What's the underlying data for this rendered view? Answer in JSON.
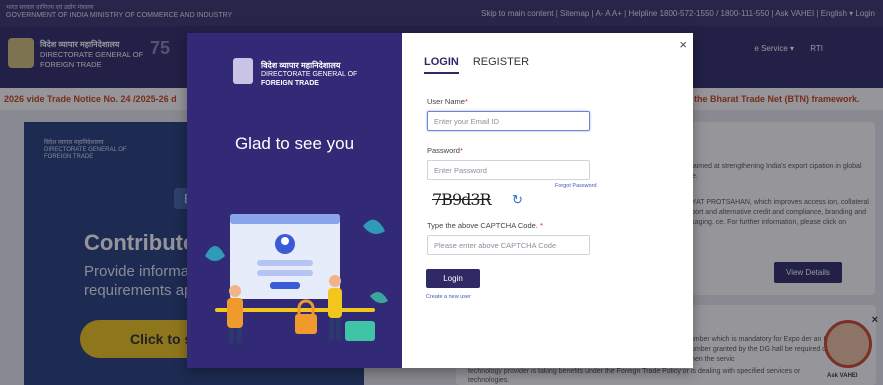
{
  "background": {
    "topbar": {
      "gov_hindi": "भारत सरकार वाणिज्य एवं उद्योग मंत्रालय",
      "gov_english": "GOVERNMENT OF INDIA MINISTRY OF COMMERCE AND INDUSTRY",
      "links": "Skip to main content  |  Sitemap  |  A-  A  A+  |  Helpline 1800-572-1550 / 1800-111-550  |  Ask VAHEI  |  English ▾  Login"
    },
    "header": {
      "hindi": "विदेश व्यापार महानिदेशालय",
      "line1": "DIRECTORATE GENERAL OF",
      "line2": "FOREIGN TRADE",
      "azadi": "75",
      "nav_items": [
        "e Service ▾",
        "RTI"
      ]
    },
    "ticker": {
      "left": "2026 vide Trade Notice No. 24 /2025-26 d",
      "right": "n the Bharat Trade Net (BTN) framework."
    },
    "banner": {
      "mini_hindi": "विदेश व्यापार महानिदेशालय",
      "mini_l1": "DIRECTORATE GENERAL OF",
      "mini_l2": "FOREIGN TRADE",
      "ex": "Ex",
      "title": "Contribute to In",
      "line1": "Provide information c",
      "line2": "requirements applicat",
      "cta": "Click to submit i"
    },
    "card": {
      "text1": "tive aimed at strengthening India's export cipation in global trade.",
      "text2": "NIRYAT PROTSAHAN, which improves access ion, collateral support and alternative credit and compliance, branding and packaging. ce. For further information, please click on",
      "button": "View Details"
    },
    "card2": {
      "text": "number which is mandatory for Expo der an IEC Number granted by the DG hall be required only when the servic",
      "text2": "technology provider is taking benefits under the Foreign Trade Policy or is dealing with specified services or technologies."
    },
    "assistant": {
      "label": "Ask VAHEI",
      "close": "×"
    }
  },
  "modal": {
    "left": {
      "brand_hindi": "विदेश व्यापार महानिदेशालय",
      "brand_line1": "DIRECTORATE GENERAL OF",
      "brand_line2": "FOREIGN TRADE",
      "greeting": "Glad to see you"
    },
    "close": "×",
    "tabs": [
      {
        "label": "LOGIN",
        "active": true
      },
      {
        "label": "REGISTER",
        "active": false
      }
    ],
    "form": {
      "username_label": "User Name",
      "username_placeholder": "Enter your Email ID",
      "password_label": "Password",
      "password_placeholder": "Enter Password",
      "forgot": "Forgot Password",
      "captcha_text": "7B9d3R",
      "captcha_label": "Type the above CAPTCHA Code.",
      "captcha_placeholder": "Please enter above CAPTCHA Code",
      "required_mark": "*",
      "login_button": "Login",
      "create_user": "Create a new user"
    },
    "colors": {
      "primary": "#2f2a66",
      "panel": "#332a77",
      "link": "#3b5db8",
      "required": "#dd2222"
    },
    "icons": [
      "close-icon",
      "refresh-icon",
      "emblem-icon"
    ]
  }
}
